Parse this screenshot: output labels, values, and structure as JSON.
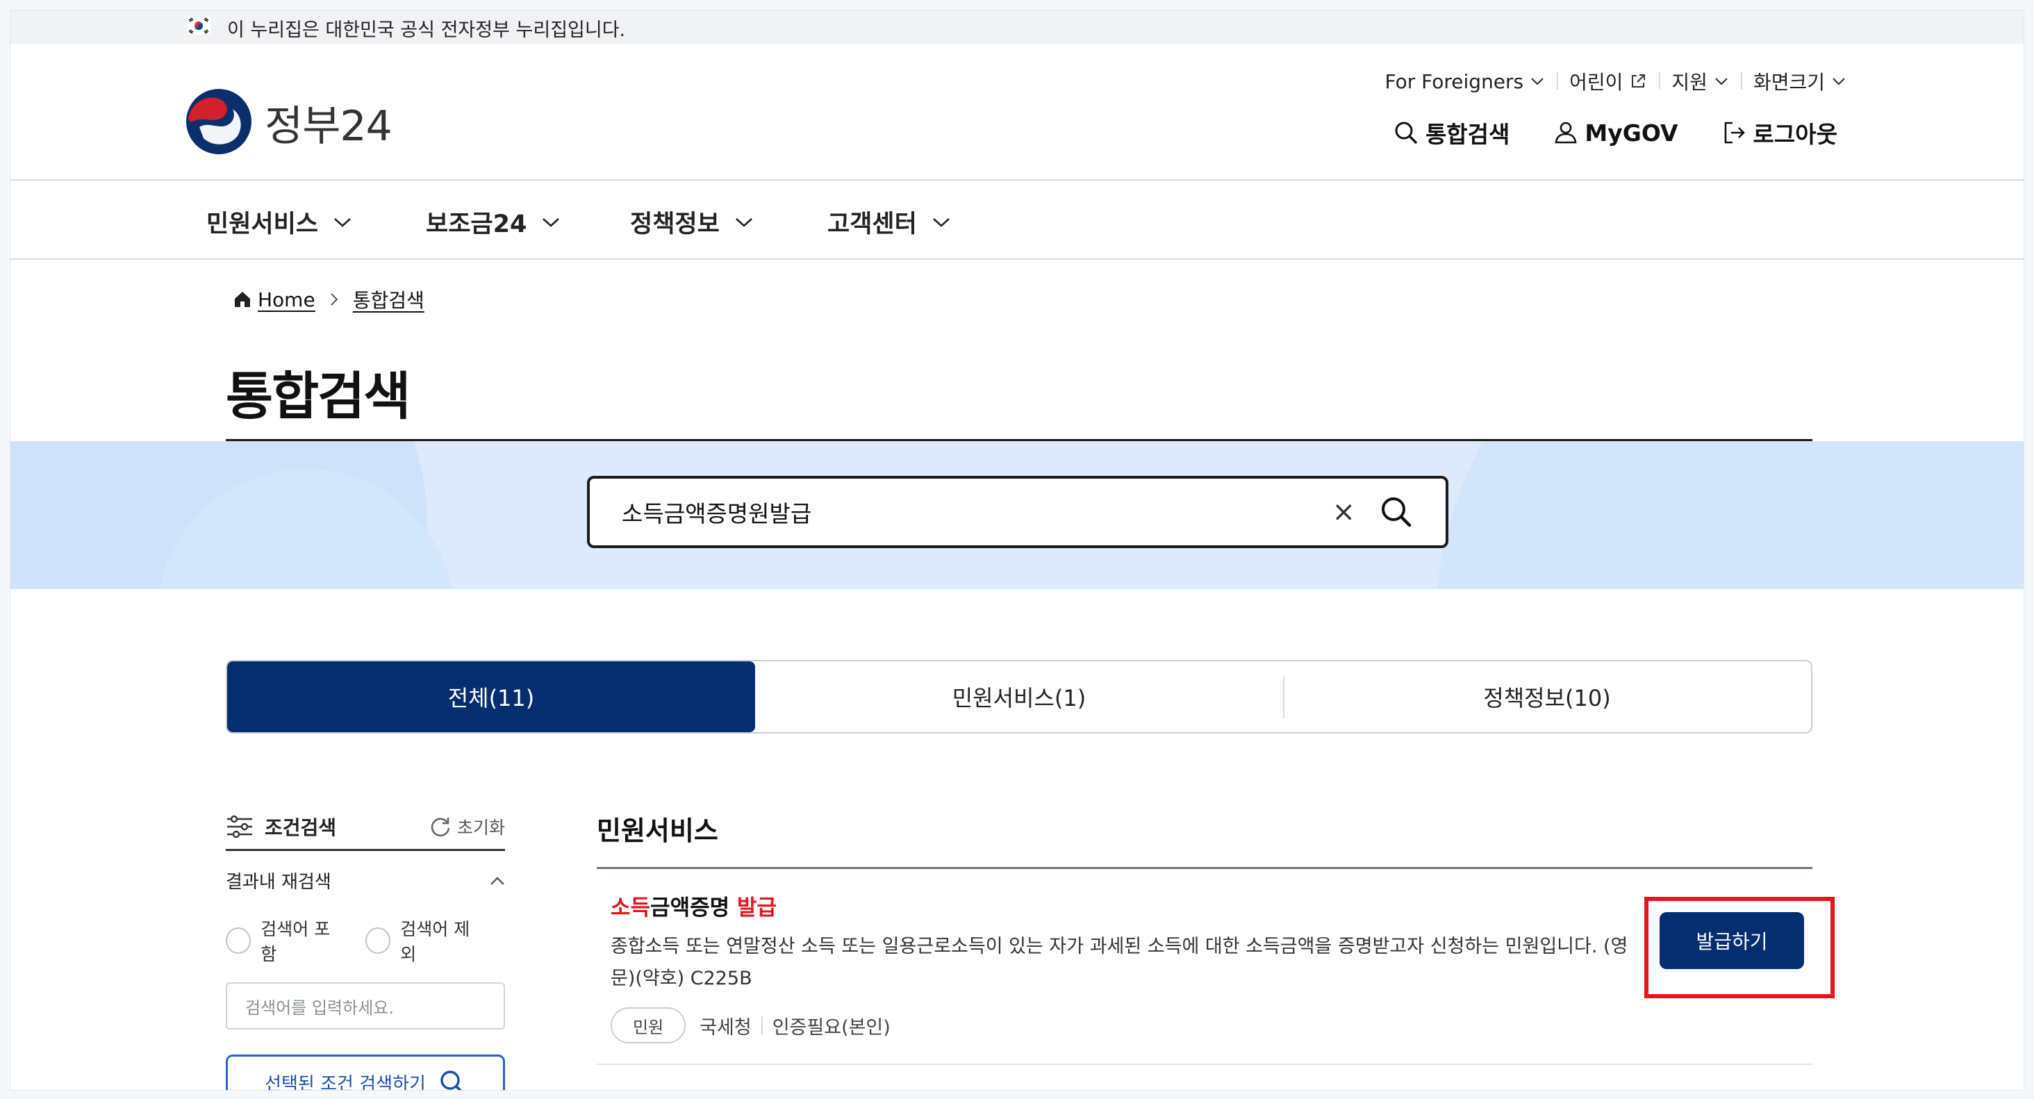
{
  "gov_banner": {
    "text": "이 누리집은 대한민국 공식 전자정부 누리집입니다."
  },
  "header": {
    "logo_text": "정부24",
    "util_nav": [
      {
        "label": "For Foreigners",
        "icon": "chevron-down-icon"
      },
      {
        "label": "어린이",
        "icon": "external-link-icon"
      },
      {
        "label": "지원",
        "icon": "chevron-down-icon"
      },
      {
        "label": "화면크기",
        "icon": "chevron-down-icon"
      }
    ],
    "main_util": [
      {
        "label": "통합검색",
        "icon": "search-icon"
      },
      {
        "label": "MyGOV",
        "icon": "user-icon"
      },
      {
        "label": "로그아웃",
        "icon": "logout-icon"
      }
    ]
  },
  "gnb": {
    "items": [
      "민원서비스",
      "보조금24",
      "정책정보",
      "고객센터"
    ]
  },
  "breadcrumb": {
    "home": "Home",
    "current": "통합검색"
  },
  "page_title": "통합검색",
  "search": {
    "value": "소득금액증명원발급",
    "clear_symbol": "×"
  },
  "tabs": [
    {
      "label": "전체(11)",
      "active": true
    },
    {
      "label": "민원서비스(1)",
      "active": false
    },
    {
      "label": "정책정보(10)",
      "active": false
    }
  ],
  "filter": {
    "title": "조건검색",
    "reset": "초기화",
    "section": "결과내 재검색",
    "radio_include": "검색어 포함",
    "radio_exclude": "검색어 제외",
    "input_placeholder": "검색어를 입력하세요.",
    "submit": "선택된 조건 검색하기"
  },
  "results": {
    "section_title": "민원서비스",
    "items": [
      {
        "title_hl1": "소득",
        "title_mid": "금액증명 ",
        "title_hl2": "발급",
        "description": "종합소득 또는 연말정산 소득 또는 일용근로소득이 있는 자가 과세된 소득에 대한 소득금액을 증명받고자 신청하는 민원입니다. (영문)(약호) C225B",
        "badge": "민원",
        "agency": "국세청",
        "auth": "인증필요(본인)",
        "button": "발급하기"
      }
    ]
  },
  "colors": {
    "primary": "#052d6f",
    "highlight": "#e3141f",
    "band": "#dceafb",
    "annotation": "#e8131b"
  }
}
